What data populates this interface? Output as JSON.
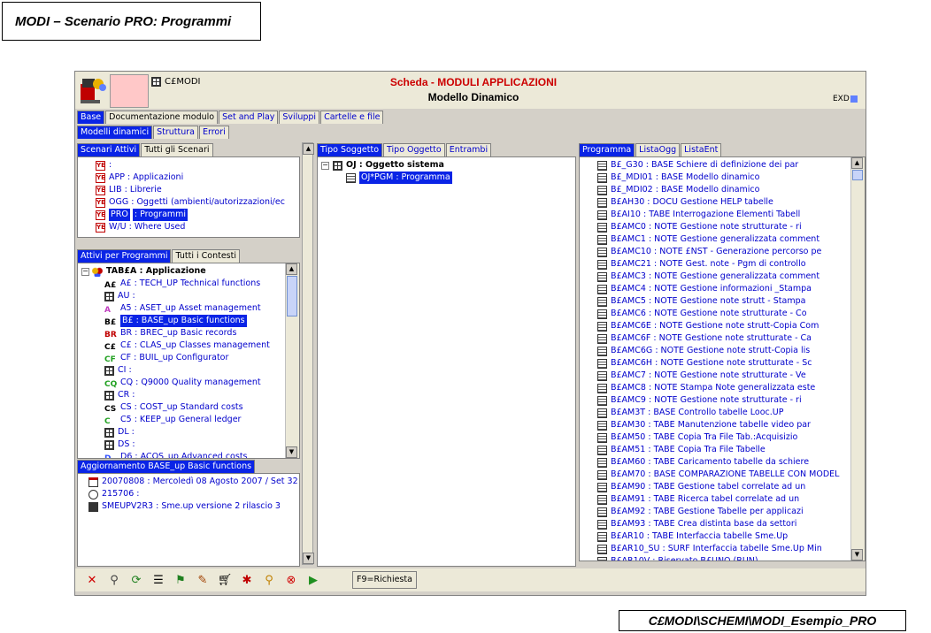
{
  "page_title": "MODI – Scenario PRO: Programmi",
  "footer_path": "C£MODI\\SCHEMI\\MODI_Esempio_PRO",
  "header": {
    "code": "C£MODI",
    "title": "Scheda - MODULI APPLICAZIONI",
    "subtitle": "Modello Dinamico",
    "exd": "EXD"
  },
  "tabs_main": [
    "Base",
    "Documentazione modulo",
    "Set and Play",
    "Sviluppi",
    "Cartelle e file"
  ],
  "tabs_sub": [
    "Modelli dinamici",
    "Struttura",
    "Errori"
  ],
  "scenari": {
    "tabs": [
      "Scenari Attivi",
      "Tutti gli Scenari"
    ],
    "items": [
      {
        "code": ":",
        "label": ""
      },
      {
        "code": "APP",
        "label": ": Applicazioni"
      },
      {
        "code": "LIB",
        "label": ": Librerie"
      },
      {
        "code": "OGG",
        "label": ": Oggetti (ambienti/autorizzazioni/ec"
      },
      {
        "code": "PRO",
        "label": ": Programmi"
      },
      {
        "code": "W/U",
        "label": ": Where Used"
      }
    ]
  },
  "attivi": {
    "tabs": [
      "Attivi per Programmi",
      "Tutti i Contesti"
    ],
    "root": "TAB£A  : Applicazione",
    "items": [
      {
        "icon": "A£",
        "text": "A£  : TECH_UP Technical functions"
      },
      {
        "icon": "grid",
        "text": "AU  :"
      },
      {
        "icon": "A5",
        "text": "A5  : ASET_up Asset management"
      },
      {
        "icon": "B£",
        "text": "B£  : BASE_up Basic functions"
      },
      {
        "icon": "BR",
        "text": "BR  : BREC_up Basic records"
      },
      {
        "icon": "C£",
        "text": "C£  : CLAS_up Classes management"
      },
      {
        "icon": "CF",
        "text": "CF  : BUIL_up Configurator"
      },
      {
        "icon": "grid",
        "text": "CI  :"
      },
      {
        "icon": "CQ",
        "text": "CQ  : Q9000   Quality management"
      },
      {
        "icon": "grid",
        "text": "CR  :"
      },
      {
        "icon": "CS",
        "text": "CS  : COST_up Standard costs"
      },
      {
        "icon": "C5",
        "text": "C5  : KEEP_up General ledger"
      },
      {
        "icon": "grid",
        "text": "DL  :"
      },
      {
        "icon": "grid",
        "text": "DS  :"
      },
      {
        "icon": "D6",
        "text": "D6  : ACOS_up Advanced costs"
      }
    ]
  },
  "aggiornamento": {
    "tab": "Aggiornamento BASE_up Basic functions",
    "items": [
      "20070808  : Mercoledì 08 Agosto 2007 / Set 32",
      "215706  :",
      "SMEUPV2R3  : Sme.up versione 2 rilascio 3"
    ]
  },
  "tipo": {
    "tabs": [
      "Tipo Soggetto",
      "Tipo Oggetto",
      "Entrambi"
    ],
    "root": "OJ  : Oggetto sistema",
    "child": "OJ*PGM  : Programma"
  },
  "programma": {
    "tabs": [
      "Programma",
      "ListaOgg",
      "ListaEnt"
    ],
    "items": [
      "B£_G30  : BASE Schiere di definizione dei par",
      "B£_MDI01  : BASE Modello dinamico",
      "B£_MDI02  : BASE Modello dinamico",
      "B£AH30  : DOCU Gestione HELP tabelle",
      "B£AI10  : TABE Interrogazione Elementi Tabell",
      "B£AMC0  : NOTE Gestione note strutturate - ri",
      "B£AMC1  : NOTE Gestione generalizzata comment",
      "B£AMC10  : NOTE £NST - Generazione percorso pe",
      "B£AMC21  : NOTE Gest. note - Pgm di controllo",
      "B£AMC3  : NOTE Gestione generalizzata comment",
      "B£AMC4  : NOTE Gestione informazioni _Stampa",
      "B£AMC5  : NOTE Gestione note strutt - Stampa",
      "B£AMC6  : NOTE Gestione note strutturate - Co",
      "B£AMC6E  : NOTE Gestione note strutt-Copia Com",
      "B£AMC6F  : NOTE Gestione note strutturate - Ca",
      "B£AMC6G  : NOTE Gestione note strutt-Copia lis",
      "B£AMC6H  : NOTE Gestione note strutturate - Sc",
      "B£AMC7  : NOTE Gestione note strutturate - Ve",
      "B£AMC8  : NOTE Stampa Note generalizzata este",
      "B£AMC9  : NOTE Gestione note strutturate - ri",
      "B£AM3T  : BASE Controllo tabelle Looc.UP",
      "B£AM30  : TABE Manutenzione tabelle video par",
      "B£AM50  : TABE Copia Tra File Tab.:Acquisizio",
      "B£AM51  : TABE Copia Tra File Tabelle",
      "B£AM60  : TABE Caricamento tabelle da schiere",
      "B£AM70  : BASE COMPARAZIONE TABELLE CON MODEL",
      "B£AM90  : TABE Gestione tabel correlate ad un",
      "B£AM91  : TABE Ricerca tabel correlate ad un",
      "B£AM92  : TABE Gestione Tabelle per applicazi",
      "B£AM93  : TABE Crea distinta base da settori",
      "B£AR10  : TABE Interfaccia tabelle Sme.Up",
      "B£AR10_SU  : SURF Interfaccia tabelle Sme.Up Min",
      "B£AR10V  : Riservato B£UNO (RUN)"
    ]
  },
  "toolbar": {
    "f9": "F9=Richiesta",
    "icons": [
      "close-icon",
      "search-icon",
      "refresh-icon",
      "list-icon",
      "flag-icon",
      "edit-icon",
      "cart-icon",
      "pin-icon",
      "zoom-icon",
      "stop-icon",
      "play-icon"
    ]
  },
  "colors": {
    "selection": "#0a24e6",
    "link": "#0000cc",
    "title_red": "#cc0000"
  }
}
